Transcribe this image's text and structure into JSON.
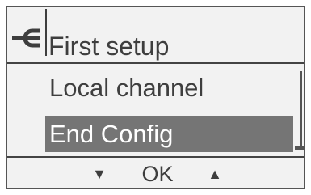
{
  "header": {
    "icon": "plug-icon",
    "title": "First setup"
  },
  "menu": {
    "items": [
      {
        "label": "Local channel",
        "selected": false
      },
      {
        "label": "End Config",
        "selected": true
      }
    ]
  },
  "footer": {
    "down_icon": "triangle-down-icon",
    "down_label": "▼",
    "ok_label": "OK",
    "up_icon": "triangle-up-icon",
    "up_label": "▲"
  },
  "colors": {
    "background": "#f2f2f2",
    "text": "#3e3e3e",
    "selection": "#757575",
    "selection_text": "#ffffff"
  }
}
